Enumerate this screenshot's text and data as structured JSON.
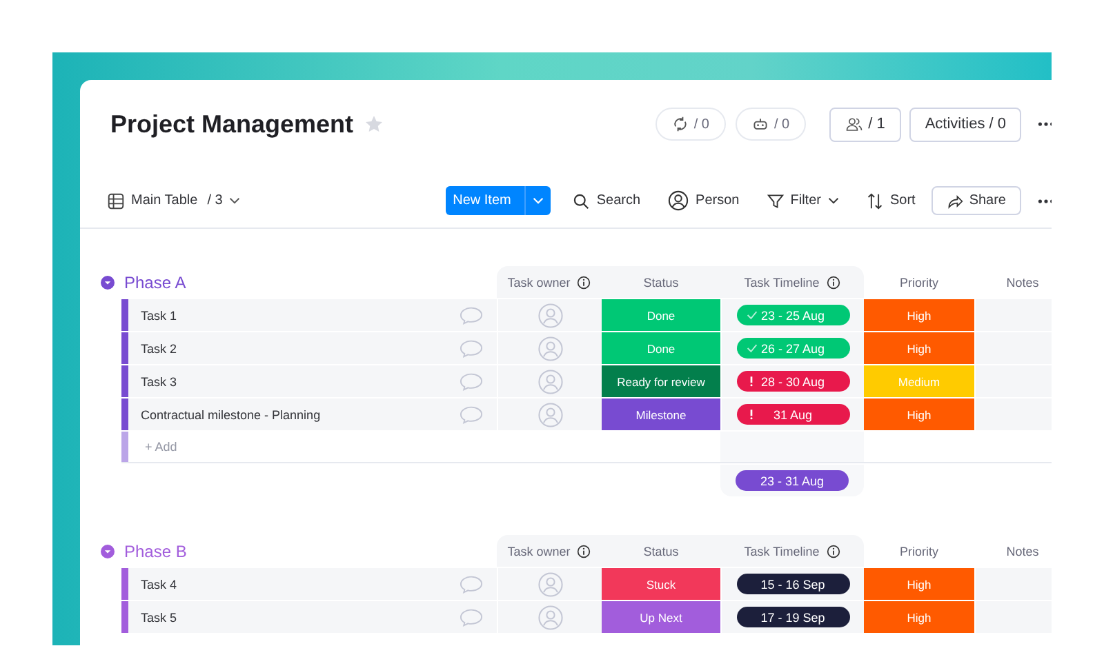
{
  "board": {
    "title": "Project Management",
    "starred": false
  },
  "header_badges": [
    {
      "kind": "automations",
      "label": "/ 0"
    },
    {
      "kind": "integrations",
      "label": "/ 0"
    }
  ],
  "members_button": {
    "label": "/ 1"
  },
  "activities_button": {
    "label": "Activities / 0"
  },
  "toolbar": {
    "view": "Main Table",
    "view_count": "/ 3",
    "new_item": "New Item",
    "actions": [
      {
        "kind": "search",
        "label": "Search"
      },
      {
        "kind": "person",
        "label": "Person"
      },
      {
        "kind": "filter",
        "label": "Filter"
      },
      {
        "kind": "sort",
        "label": "Sort"
      },
      {
        "kind": "share",
        "label": "Share"
      }
    ]
  },
  "groups": [
    {
      "title": "Phase A",
      "color": "#784bd1",
      "columns": [
        {
          "label": "Task owner",
          "info": true
        },
        {
          "label": "Status",
          "info": false
        },
        {
          "label": "Task Timeline",
          "info": true
        },
        {
          "label": "Priority",
          "info": false
        },
        {
          "label": "Notes",
          "info": false
        }
      ],
      "items": [
        {
          "name": "Task 1",
          "status": {
            "label": "Done",
            "color": "#00c875"
          },
          "timeline": {
            "label": "23 - 25 Aug",
            "color": "#00c875",
            "kind": "done"
          },
          "priority": {
            "label": "High",
            "color": "#ff5a00"
          }
        },
        {
          "name": "Task 2",
          "status": {
            "label": "Done",
            "color": "#00c875"
          },
          "timeline": {
            "label": "26 - 27 Aug",
            "color": "#00c875",
            "kind": "done"
          },
          "priority": {
            "label": "High",
            "color": "#ff5a00"
          }
        },
        {
          "name": "Task 3",
          "status": {
            "label": "Ready for review",
            "color": "#037f4c"
          },
          "timeline": {
            "label": "28 - 30 Aug",
            "color": "#e8194c",
            "kind": "overdue"
          },
          "priority": {
            "label": "Medium",
            "color": "#ffcb00"
          }
        },
        {
          "name": "Contractual milestone - Planning",
          "status": {
            "label": "Milestone",
            "color": "#784bd1"
          },
          "timeline": {
            "label": "31 Aug",
            "color": "#e8194c",
            "kind": "overdue"
          },
          "priority": {
            "label": "High",
            "color": "#ff5a00"
          }
        }
      ],
      "add_label": "+ Add",
      "summary": {
        "label": "23 - 31 Aug",
        "color": "#784bd1"
      }
    },
    {
      "title": "Phase B",
      "color": "#a25ddc",
      "columns": [
        {
          "label": "Task owner",
          "info": true
        },
        {
          "label": "Status",
          "info": false
        },
        {
          "label": "Task Timeline",
          "info": true
        },
        {
          "label": "Priority",
          "info": false
        },
        {
          "label": "Notes",
          "info": false
        }
      ],
      "items": [
        {
          "name": "Task 4",
          "status": {
            "label": "Stuck",
            "color": "#f2385a"
          },
          "timeline": {
            "label": "15 - 16 Sep",
            "color": "#1c1f3b",
            "kind": "plain"
          },
          "priority": {
            "label": "High",
            "color": "#ff5a00"
          }
        },
        {
          "name": "Task 5",
          "status": {
            "label": "Up Next",
            "color": "#a25ddc"
          },
          "timeline": {
            "label": "17 - 19 Sep",
            "color": "#1c1f3b",
            "kind": "plain"
          },
          "priority": {
            "label": "High",
            "color": "#ff5a00"
          }
        }
      ]
    }
  ]
}
